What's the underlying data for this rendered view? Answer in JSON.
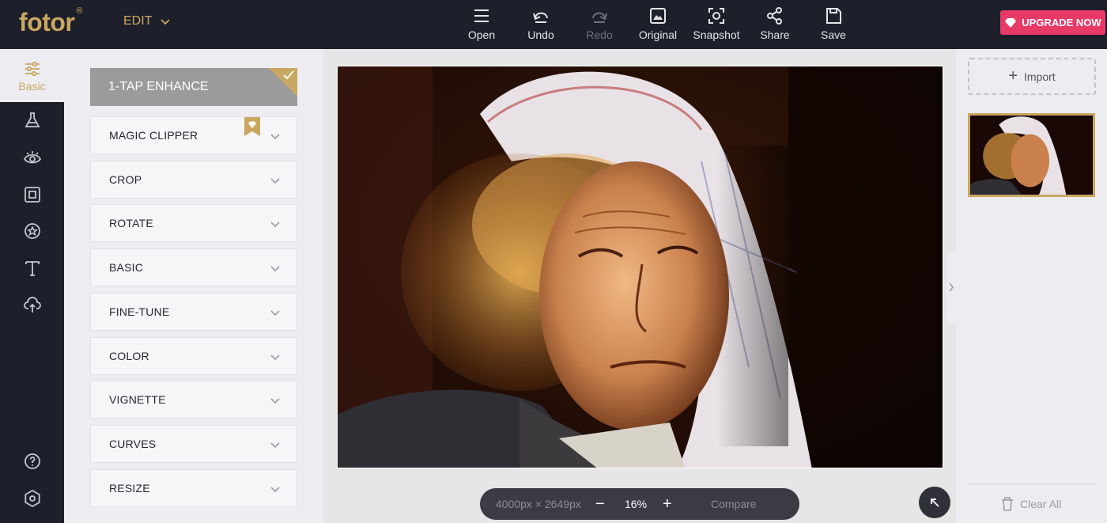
{
  "app": {
    "logo": "fotor",
    "logo_mark": "®",
    "mode": "EDIT"
  },
  "toolbar": [
    {
      "label": "Open",
      "icon": "menu-icon",
      "enabled": true
    },
    {
      "label": "Undo",
      "icon": "undo-icon",
      "enabled": true
    },
    {
      "label": "Redo",
      "icon": "redo-icon",
      "enabled": false
    },
    {
      "label": "Original",
      "icon": "image-icon",
      "enabled": true
    },
    {
      "label": "Snapshot",
      "icon": "snapshot-icon",
      "enabled": true
    },
    {
      "label": "Share",
      "icon": "share-icon",
      "enabled": true
    },
    {
      "label": "Save",
      "icon": "save-icon",
      "enabled": true
    }
  ],
  "upgrade": {
    "label": "UPGRADE NOW",
    "icon": "diamond-icon",
    "color": "#e73a67"
  },
  "rail": {
    "active_label": "Basic",
    "items": [
      "sliders-icon",
      "flask-icon",
      "eye-icon",
      "frame-icon",
      "star-badge-icon",
      "text-icon",
      "cloud-upload-icon"
    ],
    "bottom": [
      "help-icon",
      "settings-icon"
    ]
  },
  "panel": {
    "enhance_label": "1-TAP ENHANCE",
    "tools": [
      {
        "label": "MAGIC CLIPPER",
        "premium": true
      },
      {
        "label": "CROP"
      },
      {
        "label": "ROTATE"
      },
      {
        "label": "BASIC"
      },
      {
        "label": "FINE-TUNE"
      },
      {
        "label": "COLOR"
      },
      {
        "label": "VIGNETTE"
      },
      {
        "label": "CURVES"
      },
      {
        "label": "RESIZE"
      }
    ]
  },
  "canvas": {
    "dimensions": "4000px × 2649px",
    "zoom": "16%",
    "zoom_out": "−",
    "zoom_in": "+",
    "compare_label": "Compare"
  },
  "right_panel": {
    "import_label": "Import",
    "clear_label": "Clear All"
  },
  "colors": {
    "accent": "#c9a760",
    "dark": "#1d1f2b",
    "upgrade": "#e73a67"
  }
}
